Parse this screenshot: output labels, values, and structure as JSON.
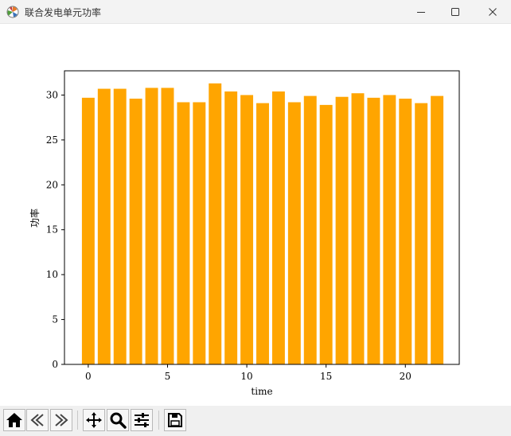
{
  "window": {
    "title": "联合发电单元功率"
  },
  "toolbar": {
    "buttons": [
      "home-icon",
      "back-icon",
      "forward-icon",
      "pan-icon",
      "zoom-icon",
      "configure-subplots-icon",
      "save-icon"
    ]
  },
  "chart_data": {
    "type": "bar",
    "xlabel": "time",
    "ylabel": "功率",
    "x": [
      0,
      1,
      2,
      3,
      4,
      5,
      6,
      7,
      8,
      9,
      10,
      11,
      12,
      13,
      14,
      15,
      16,
      17,
      18,
      19,
      20,
      21,
      22
    ],
    "values": [
      29.7,
      30.7,
      30.7,
      29.6,
      30.8,
      30.8,
      29.2,
      29.2,
      31.3,
      30.4,
      30.0,
      29.1,
      30.4,
      29.2,
      29.9,
      28.9,
      29.8,
      30.2,
      29.7,
      30.0,
      29.6,
      29.1,
      29.9
    ],
    "xticks": [
      0,
      5,
      10,
      15,
      20
    ],
    "yticks": [
      0,
      5,
      10,
      15,
      20,
      25,
      30
    ],
    "xlim": [
      -1.5,
      23.4
    ],
    "ylim": [
      0,
      32.7
    ],
    "bar_color": "#ffa500",
    "grid": false
  }
}
